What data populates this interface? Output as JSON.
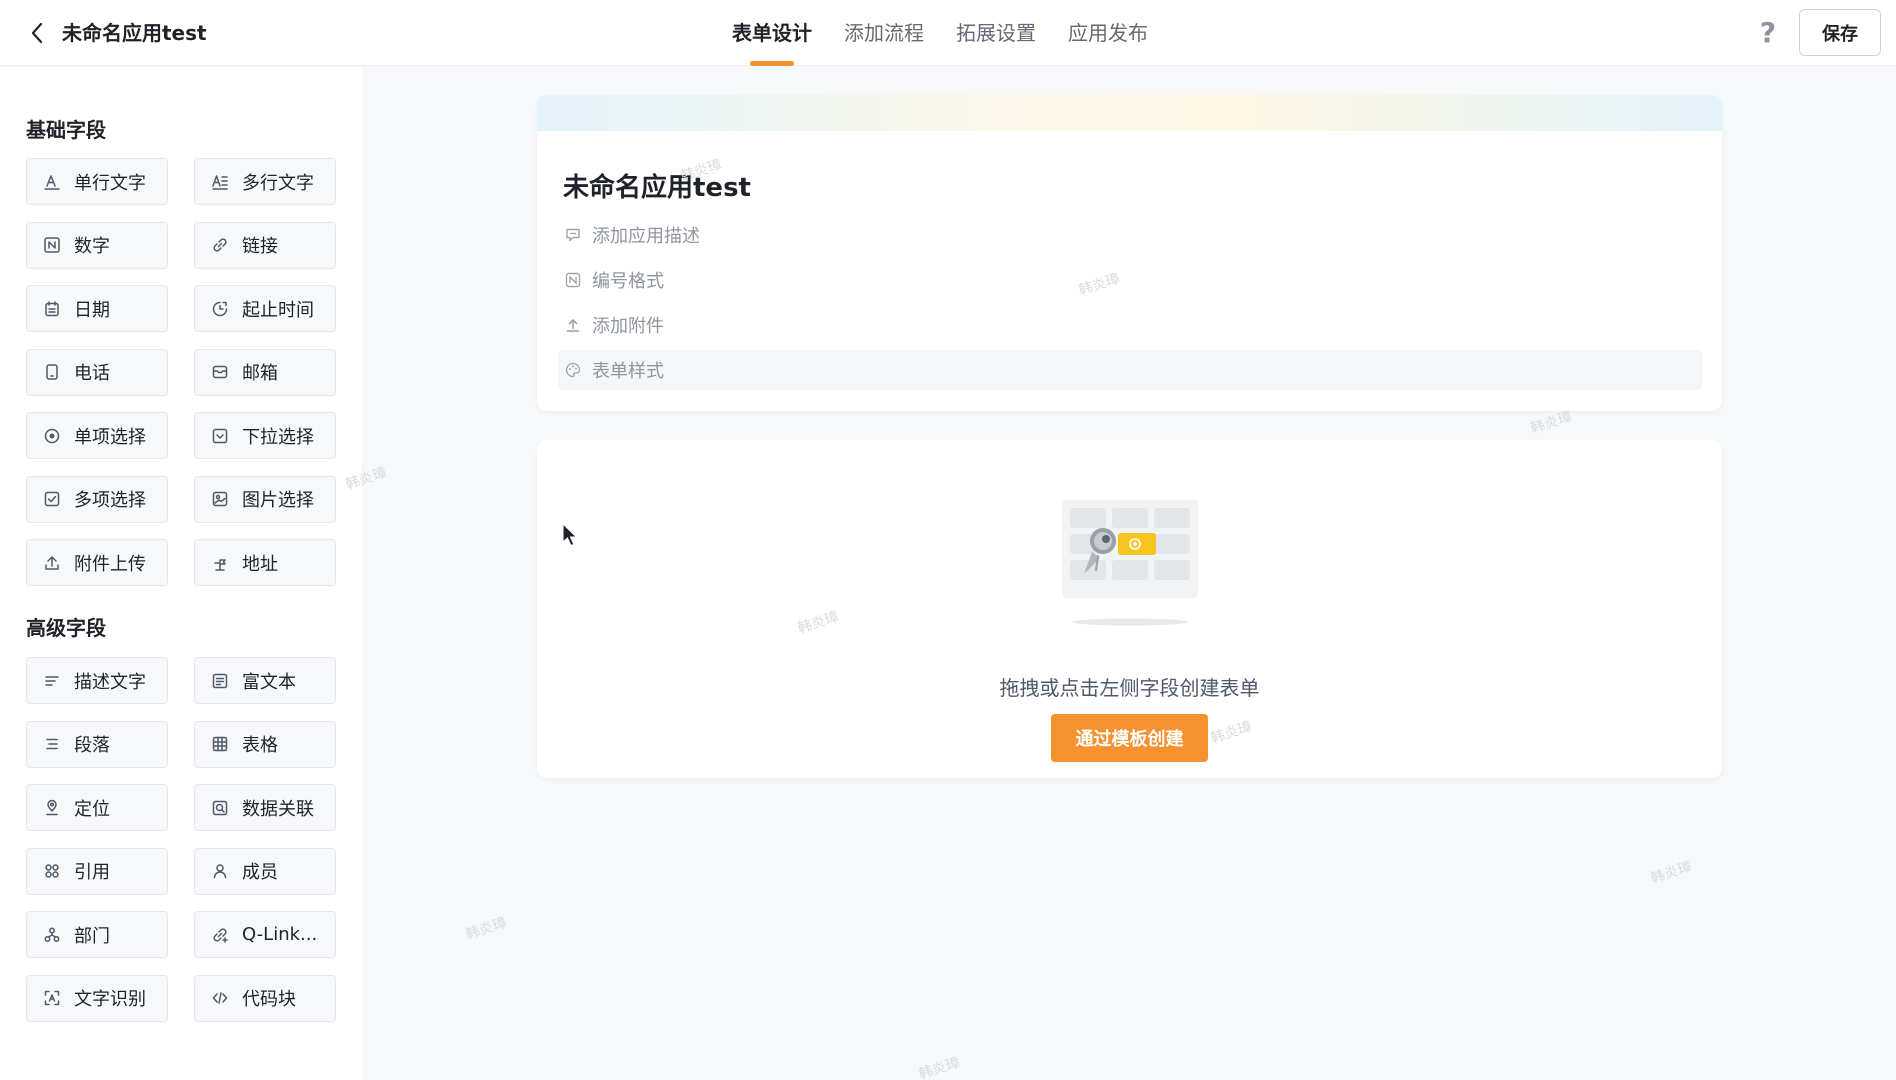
{
  "header": {
    "app_name": "未命名应用test",
    "tabs": [
      "表单设计",
      "添加流程",
      "拓展设置",
      "应用发布"
    ],
    "active_tab": 0,
    "help_label": "?",
    "save_label": "保存"
  },
  "sidebar": {
    "basic_title": "基础字段",
    "basic_fields": [
      {
        "label": "单行文字",
        "icon": "text-icon"
      },
      {
        "label": "多行文字",
        "icon": "multiline-text-icon"
      },
      {
        "label": "数字",
        "icon": "number-icon"
      },
      {
        "label": "链接",
        "icon": "link-icon"
      },
      {
        "label": "日期",
        "icon": "calendar-icon"
      },
      {
        "label": "起止时间",
        "icon": "time-range-icon"
      },
      {
        "label": "电话",
        "icon": "phone-icon"
      },
      {
        "label": "邮箱",
        "icon": "mail-icon"
      },
      {
        "label": "单项选择",
        "icon": "radio-icon"
      },
      {
        "label": "下拉选择",
        "icon": "dropdown-icon"
      },
      {
        "label": "多项选择",
        "icon": "checkbox-icon"
      },
      {
        "label": "图片选择",
        "icon": "image-icon"
      },
      {
        "label": "附件上传",
        "icon": "upload-icon"
      },
      {
        "label": "地址",
        "icon": "address-icon"
      }
    ],
    "advanced_title": "高级字段",
    "advanced_fields": [
      {
        "label": "描述文字",
        "icon": "description-icon"
      },
      {
        "label": "富文本",
        "icon": "rich-text-icon"
      },
      {
        "label": "段落",
        "icon": "paragraph-icon"
      },
      {
        "label": "表格",
        "icon": "table-icon"
      },
      {
        "label": "定位",
        "icon": "location-icon"
      },
      {
        "label": "数据关联",
        "icon": "data-link-icon"
      },
      {
        "label": "引用",
        "icon": "reference-icon"
      },
      {
        "label": "成员",
        "icon": "member-icon"
      },
      {
        "label": "部门",
        "icon": "department-icon"
      },
      {
        "label": "Q-Link...",
        "icon": "qlink-icon"
      },
      {
        "label": "文字识别",
        "icon": "ocr-icon"
      },
      {
        "label": "代码块",
        "icon": "code-icon"
      }
    ]
  },
  "form": {
    "title": "未命名应用test",
    "meta": [
      "添加应用描述",
      "编号格式",
      "添加附件",
      "表单样式"
    ]
  },
  "empty": {
    "text": "拖拽或点击左侧字段创建表单",
    "button": "通过模板创建"
  },
  "watermark": "韩炎璋",
  "colors": {
    "accent": "#f5912e"
  }
}
